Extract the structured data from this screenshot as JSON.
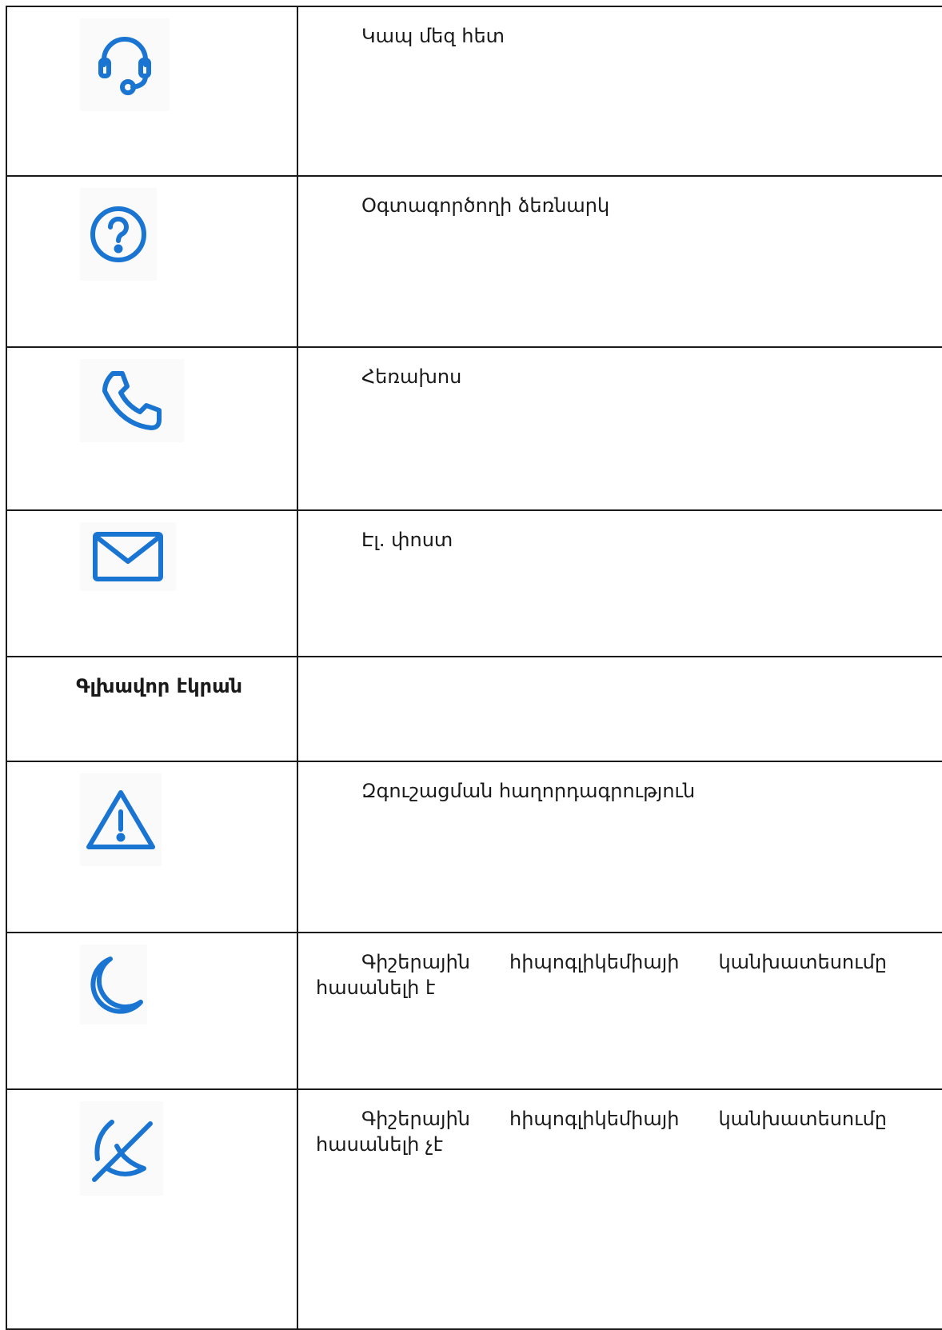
{
  "accent_color": "#1a75d2",
  "rows": [
    {
      "icon": "headset-icon",
      "text": "Կապ մեզ հետ"
    },
    {
      "icon": "question-circle-icon",
      "text": "Օգտագործողի ձեռնարկ"
    },
    {
      "icon": "phone-icon",
      "text": "Հեռախոս"
    },
    {
      "icon": "envelope-icon",
      "text": "Էլ. փոստ"
    },
    {
      "heading": "Գլխավոր էկրան"
    },
    {
      "icon": "warning-triangle-icon",
      "text": "Զգուշացման հաղորդագրություն"
    },
    {
      "icon": "moon-icon",
      "text": "Գիշերային հիպոգլիկեմիայի կանխատեսումը հասանելի է"
    },
    {
      "icon": "moon-off-icon",
      "text": "Գիշերային հիպոգլիկեմիայի կանխատեսումը հասանելի չէ"
    }
  ]
}
